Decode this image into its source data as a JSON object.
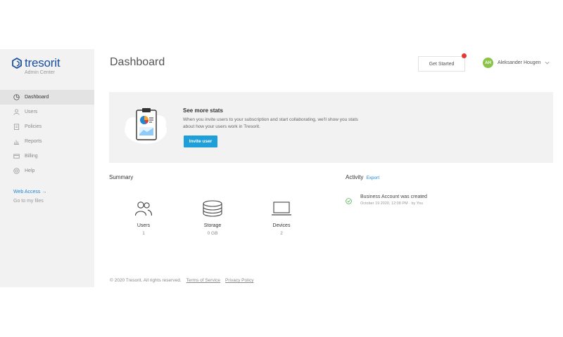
{
  "brand": {
    "name": "tresorit",
    "subtitle": "Admin Center"
  },
  "sidebar": {
    "items": [
      {
        "label": "Dashboard",
        "icon": "dashboard-icon",
        "active": true
      },
      {
        "label": "Users",
        "icon": "user-icon"
      },
      {
        "label": "Policies",
        "icon": "policies-icon"
      },
      {
        "label": "Reports",
        "icon": "reports-icon"
      },
      {
        "label": "Billing",
        "icon": "billing-icon"
      },
      {
        "label": "Help",
        "icon": "help-icon"
      }
    ],
    "web_access": "Web Access →",
    "go_to_files": "Go to my files"
  },
  "header": {
    "title": "Dashboard",
    "get_started": "Get Started",
    "user_initials": "AH",
    "user_name": "Aleksander Hougen"
  },
  "banner": {
    "title": "See more stats",
    "text": "When you invite users to your subscription and start collaborating, we'll show you stats about how your users work in Tresorit.",
    "button": "Invite user"
  },
  "summary": {
    "title": "Summary",
    "stats": [
      {
        "label": "Users",
        "value": "1",
        "icon": "users-icon"
      },
      {
        "label": "Storage",
        "value": "0 GB",
        "icon": "storage-icon"
      },
      {
        "label": "Devices",
        "value": "2",
        "icon": "devices-icon"
      }
    ]
  },
  "activity": {
    "title": "Activity",
    "export": "Export",
    "items": [
      {
        "title": "Business Account was created",
        "meta": "October 19 2020, 12:08 PM · by You"
      }
    ]
  },
  "footer": {
    "copyright": "© 2020 Tresorit. All rights reserved.",
    "terms": "Terms of Service",
    "privacy": "Privacy Policy"
  },
  "colors": {
    "brand_blue": "#1a4fa0",
    "accent": "#1e9fd9",
    "success": "#4caf50",
    "avatar": "#8bc34a",
    "notification": "#e53935"
  }
}
